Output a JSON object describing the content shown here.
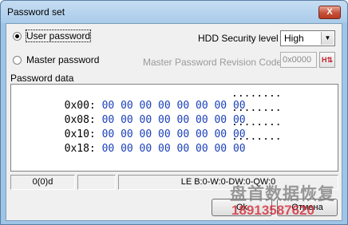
{
  "window": {
    "title": "Password set",
    "close_label": "X"
  },
  "radios": {
    "user_password": {
      "label": "User password",
      "checked": true
    },
    "master_password": {
      "label": "Master password",
      "checked": false
    }
  },
  "security": {
    "label": "HDD Security level",
    "selected": "High",
    "arrow": "▼"
  },
  "revision": {
    "label": "Master Password Revision Code",
    "value": "0x0000",
    "hex_button_label": "H⇅"
  },
  "password_data": {
    "label": "Password data",
    "rows": [
      {
        "addr": "0x00:",
        "bytes": "00 00 00 00 00 00 00 00",
        "ascii": "........"
      },
      {
        "addr": "0x08:",
        "bytes": "00 00 00 00 00 00 00 00",
        "ascii": "........"
      },
      {
        "addr": "0x10:",
        "bytes": "00 00 00 00 00 00 00 00",
        "ascii": "........"
      },
      {
        "addr": "0x18:",
        "bytes": "00 00 00 00 00 00 00 00",
        "ascii": "........"
      }
    ]
  },
  "statusbar": {
    "position": "0(0)d",
    "empty": "",
    "endian": "LE B:0-W:0-DW:0-QW:0"
  },
  "buttons": {
    "ok": "Ok",
    "cancel": "Отмена"
  },
  "watermark": {
    "line1": "盘首数据恢复",
    "line2": "18913587620"
  }
}
